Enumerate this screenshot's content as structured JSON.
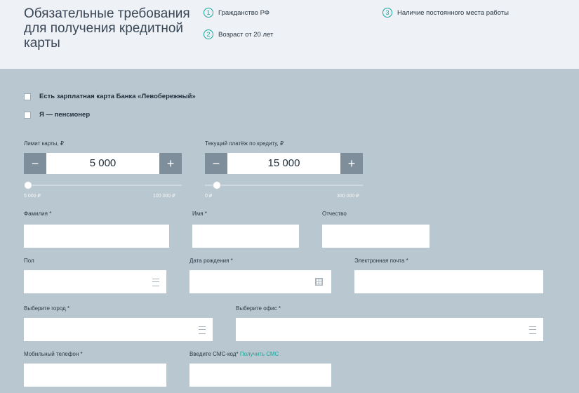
{
  "requirements": {
    "title": "Обязательные требования для получения кредитной карты",
    "items": [
      {
        "num": "1",
        "text": "Гражданство РФ"
      },
      {
        "num": "2",
        "text": "Возраст от 20 лет"
      },
      {
        "num": "3",
        "text": "Наличие постоянного места работы"
      }
    ]
  },
  "checkboxes": {
    "salary_card": "Есть зарплатная карта Банка «Левобережный»",
    "pensioner": "Я — пенсионер"
  },
  "limit": {
    "label": "Лимит карты, ₽",
    "value": "5 000",
    "minus": "−",
    "plus": "+",
    "min_label": "5 000 ₽",
    "max_label": "100 000 ₽",
    "slider_fraction": 0.0
  },
  "payment": {
    "label": "Текущий платёж по кредиту, ₽",
    "value": "15 000",
    "minus": "−",
    "plus": "+",
    "min_label": "0 ₽",
    "max_label": "300 000 ₽",
    "slider_fraction": 0.05
  },
  "fields": {
    "surname": {
      "label": "Фамилия *",
      "value": ""
    },
    "name": {
      "label": "Имя *",
      "value": ""
    },
    "patronymic": {
      "label": "Отчество",
      "value": ""
    },
    "gender": {
      "label": "Пол",
      "value": "",
      "icon": "menu-icon"
    },
    "birthdate": {
      "label": "Дата рождения *",
      "value": "",
      "icon": "calendar-icon"
    },
    "email": {
      "label": "Электронная почта *",
      "value": ""
    },
    "city": {
      "label": "Выберите город *",
      "value": "",
      "icon": "menu-icon"
    },
    "office": {
      "label": "Выберите офис *",
      "value": "",
      "icon": "menu-icon"
    },
    "phone": {
      "label": "Мобильный телефон *",
      "value": ""
    },
    "sms": {
      "label": "Введите СМС-код*",
      "link": "Получить СМС",
      "value": ""
    }
  },
  "colors": {
    "form_bg": "#b9c8d0",
    "top_bg": "#eef2f6",
    "accent": "#14a69b",
    "stepper_button": "#7f8e9b"
  }
}
